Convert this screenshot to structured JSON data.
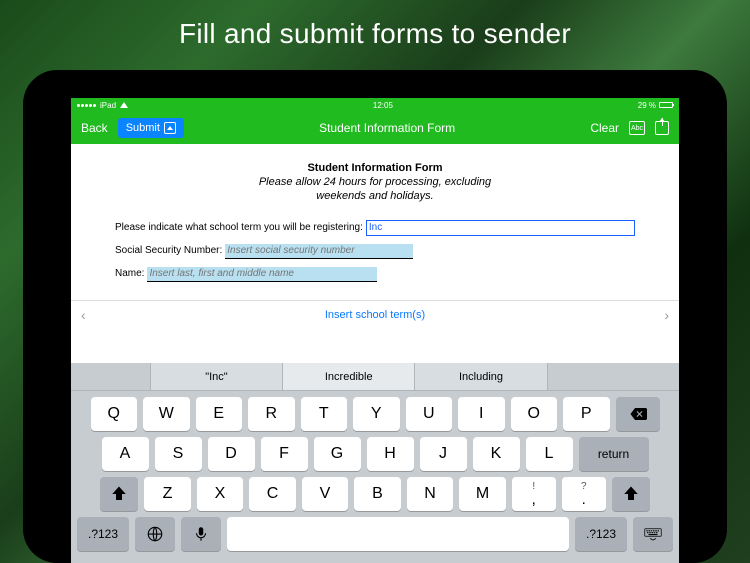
{
  "promo": {
    "title": "Fill and submit forms to sender"
  },
  "statusbar": {
    "device": "iPad",
    "time": "12:05",
    "battery": "29 %"
  },
  "navbar": {
    "back": "Back",
    "submit": "Submit",
    "title": "Student Information Form",
    "clear": "Clear",
    "abc": "Abc"
  },
  "document": {
    "title": "Student Information Form",
    "subtitle_l1": "Please allow 24 hours for processing, excluding",
    "subtitle_l2": "weekends and holidays.",
    "school_label": "Please indicate what school term you will be registering:",
    "school_value": "Inc",
    "ssn_label": "Social Security Number:",
    "ssn_placeholder": "Insert social security number",
    "name_label": "Name:",
    "name_placeholder": "Insert last, first and middle name"
  },
  "suggestion_bar": {
    "text": "Insert school term(s)"
  },
  "predictions": {
    "p1": "\"Inc\"",
    "p2": "Incredible",
    "p3": "Including"
  },
  "keys": {
    "row1": [
      "Q",
      "W",
      "E",
      "R",
      "T",
      "Y",
      "U",
      "I",
      "O",
      "P"
    ],
    "row2": [
      "A",
      "S",
      "D",
      "F",
      "G",
      "H",
      "J",
      "K",
      "L"
    ],
    "row3": [
      "Z",
      "X",
      "C",
      "V",
      "B",
      "N",
      "M"
    ],
    "punct1_top": "!",
    "punct1_bot": ",",
    "punct2_top": "?",
    "punct2_bot": ".",
    "return": "return",
    "numsym": ".?123"
  }
}
